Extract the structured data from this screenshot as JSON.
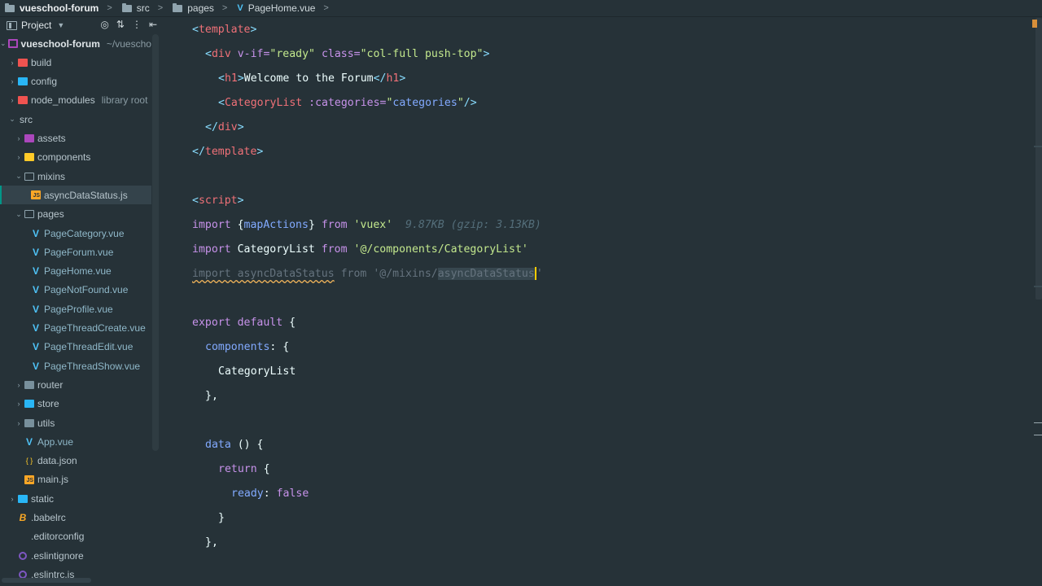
{
  "breadcrumb": {
    "items": [
      {
        "label": "vueschool-forum",
        "icon": "folder-icon",
        "bold": true
      },
      {
        "label": "src",
        "icon": "folder-icon"
      },
      {
        "label": "pages",
        "icon": "folder-icon"
      },
      {
        "label": "PageHome.vue",
        "icon": "vue-file-icon"
      }
    ]
  },
  "project_panel": {
    "title": "Project",
    "tool_icons": [
      "target-icon",
      "collapse-icon",
      "more-icon",
      "hide-panel-icon"
    ]
  },
  "tree": [
    {
      "label": "vueschool-forum",
      "note": "~/vueschool",
      "depth": 0,
      "expanded": true,
      "icon": "folder-root-icon",
      "root": true
    },
    {
      "label": "build",
      "depth": 1,
      "expanded": false,
      "icon": "folder-red-icon"
    },
    {
      "label": "config",
      "depth": 1,
      "expanded": false,
      "icon": "folder-blue-icon"
    },
    {
      "label": "node_modules",
      "note": "library root",
      "depth": 1,
      "expanded": false,
      "icon": "folder-red-icon"
    },
    {
      "label": "src",
      "depth": 1,
      "expanded": true,
      "icon": "none"
    },
    {
      "label": "assets",
      "depth": 2,
      "expanded": false,
      "icon": "folder-purple-icon"
    },
    {
      "label": "components",
      "depth": 2,
      "expanded": false,
      "icon": "folder-yellow-icon"
    },
    {
      "label": "mixins",
      "depth": 2,
      "expanded": true,
      "icon": "folder-outline-icon"
    },
    {
      "label": "asyncDataStatus.js",
      "depth": 3,
      "icon": "js-file-icon",
      "selected": true
    },
    {
      "label": "pages",
      "depth": 2,
      "expanded": true,
      "icon": "folder-outline-icon"
    },
    {
      "label": "PageCategory.vue",
      "depth": 3,
      "icon": "vue-file-icon"
    },
    {
      "label": "PageForum.vue",
      "depth": 3,
      "icon": "vue-file-icon"
    },
    {
      "label": "PageHome.vue",
      "depth": 3,
      "icon": "vue-file-icon"
    },
    {
      "label": "PageNotFound.vue",
      "depth": 3,
      "icon": "vue-file-icon"
    },
    {
      "label": "PageProfile.vue",
      "depth": 3,
      "icon": "vue-file-icon"
    },
    {
      "label": "PageThreadCreate.vue",
      "depth": 3,
      "icon": "vue-file-icon"
    },
    {
      "label": "PageThreadEdit.vue",
      "depth": 3,
      "icon": "vue-file-icon"
    },
    {
      "label": "PageThreadShow.vue",
      "depth": 3,
      "icon": "vue-file-icon"
    },
    {
      "label": "router",
      "depth": 2,
      "expanded": false,
      "icon": "folder-grey-icon"
    },
    {
      "label": "store",
      "depth": 2,
      "expanded": false,
      "icon": "folder-blue-icon"
    },
    {
      "label": "utils",
      "depth": 2,
      "expanded": false,
      "icon": "folder-grey-icon"
    },
    {
      "label": "App.vue",
      "depth": 2,
      "icon": "vue-file-icon"
    },
    {
      "label": "data.json",
      "depth": 2,
      "icon": "json-file-icon"
    },
    {
      "label": "main.js",
      "depth": 2,
      "icon": "js-file-icon"
    },
    {
      "label": "static",
      "depth": 1,
      "expanded": false,
      "icon": "folder-blue-icon"
    },
    {
      "label": ".babelrc",
      "depth": 1,
      "icon": "babel-file-icon"
    },
    {
      "label": ".editorconfig",
      "depth": 1,
      "icon": "editorconfig-file-icon"
    },
    {
      "label": ".eslintignore",
      "depth": 1,
      "icon": "eslint-file-icon"
    },
    {
      "label": ".eslintrc.js",
      "depth": 1,
      "icon": "eslint-file-icon"
    }
  ],
  "editor": {
    "file": "PageHome.vue",
    "lines": [
      {
        "indent": 0,
        "tokens": [
          [
            "tag-punct",
            "<"
          ],
          [
            "tag",
            "template"
          ],
          [
            "tag-punct",
            ">"
          ]
        ]
      },
      {
        "indent": 1,
        "tokens": [
          [
            "tag-punct",
            "<"
          ],
          [
            "tag",
            "div "
          ],
          [
            "attr",
            "v-if="
          ],
          [
            "str",
            "\"ready\""
          ],
          [
            "text",
            " "
          ],
          [
            "attr",
            "class="
          ],
          [
            "str",
            "\"col-full push-top\""
          ],
          [
            "tag-punct",
            ">"
          ]
        ]
      },
      {
        "indent": 2,
        "tokens": [
          [
            "tag-punct",
            "<"
          ],
          [
            "tag",
            "h1"
          ],
          [
            "tag-punct",
            ">"
          ],
          [
            "text",
            "Welcome to the Forum"
          ],
          [
            "tag-punct",
            "</"
          ],
          [
            "tag",
            "h1"
          ],
          [
            "tag-punct",
            ">"
          ]
        ]
      },
      {
        "indent": 2,
        "tokens": [
          [
            "tag-punct",
            "<"
          ],
          [
            "tag",
            "CategoryList "
          ],
          [
            "attr",
            ":categories="
          ],
          [
            "str",
            "\""
          ],
          [
            "prop",
            "categories"
          ],
          [
            "str",
            "\""
          ],
          [
            "tag-punct",
            "/>"
          ]
        ]
      },
      {
        "indent": 1,
        "tokens": [
          [
            "tag-punct",
            "</"
          ],
          [
            "tag",
            "div"
          ],
          [
            "tag-punct",
            ">"
          ]
        ]
      },
      {
        "indent": 0,
        "tokens": [
          [
            "tag-punct",
            "</"
          ],
          [
            "tag",
            "template"
          ],
          [
            "tag-punct",
            ">"
          ]
        ]
      },
      {
        "indent": 0,
        "tokens": []
      },
      {
        "indent": 0,
        "tokens": [
          [
            "tag-punct",
            "<"
          ],
          [
            "tag",
            "script"
          ],
          [
            "tag-punct",
            ">"
          ]
        ]
      },
      {
        "indent": 0,
        "tokens": [
          [
            "kw",
            "import "
          ],
          [
            "punct",
            "{"
          ],
          [
            "prop",
            "mapActions"
          ],
          [
            "punct",
            "}"
          ],
          [
            "kw",
            " from "
          ],
          [
            "str",
            "'vuex'"
          ],
          [
            "hint",
            "  9.87KB (gzip: 3.13KB)"
          ]
        ]
      },
      {
        "indent": 0,
        "tokens": [
          [
            "kw",
            "import "
          ],
          [
            "text",
            "CategoryList"
          ],
          [
            "kw",
            " from "
          ],
          [
            "str",
            "'@/components/CategoryList'"
          ]
        ]
      },
      {
        "indent": 0,
        "tokens": [
          [
            "unused",
            "import asyncDataStatus"
          ],
          [
            "unused2",
            " from "
          ],
          [
            "unused2",
            "'@/mixins/"
          ],
          [
            "hl",
            "asyncDataStatus"
          ],
          [
            "cursor",
            ""
          ],
          [
            "unused2",
            "'"
          ]
        ]
      },
      {
        "indent": 0,
        "tokens": []
      },
      {
        "indent": 0,
        "tokens": [
          [
            "kw",
            "export default "
          ],
          [
            "punct",
            "{"
          ]
        ]
      },
      {
        "indent": 1,
        "tokens": [
          [
            "prop",
            "components"
          ],
          [
            "punct",
            ": {"
          ]
        ]
      },
      {
        "indent": 2,
        "tokens": [
          [
            "text",
            "CategoryList"
          ]
        ]
      },
      {
        "indent": 1,
        "tokens": [
          [
            "punct",
            "},"
          ]
        ]
      },
      {
        "indent": 0,
        "tokens": []
      },
      {
        "indent": 1,
        "tokens": [
          [
            "fn",
            "data "
          ],
          [
            "punct",
            "() {"
          ]
        ]
      },
      {
        "indent": 2,
        "tokens": [
          [
            "kw",
            "return "
          ],
          [
            "punct",
            "{"
          ]
        ]
      },
      {
        "indent": 3,
        "tokens": [
          [
            "prop",
            "ready"
          ],
          [
            "punct",
            ": "
          ],
          [
            "kw",
            "false"
          ]
        ]
      },
      {
        "indent": 2,
        "tokens": [
          [
            "punct",
            "}"
          ]
        ]
      },
      {
        "indent": 1,
        "tokens": [
          [
            "punct",
            "},"
          ]
        ]
      }
    ]
  },
  "colors": {
    "background": "#263238",
    "tag": "#f07178",
    "string": "#c3e88d",
    "keyword": "#c792ea",
    "accent": "#009688",
    "cursor": "#ffcc00"
  }
}
